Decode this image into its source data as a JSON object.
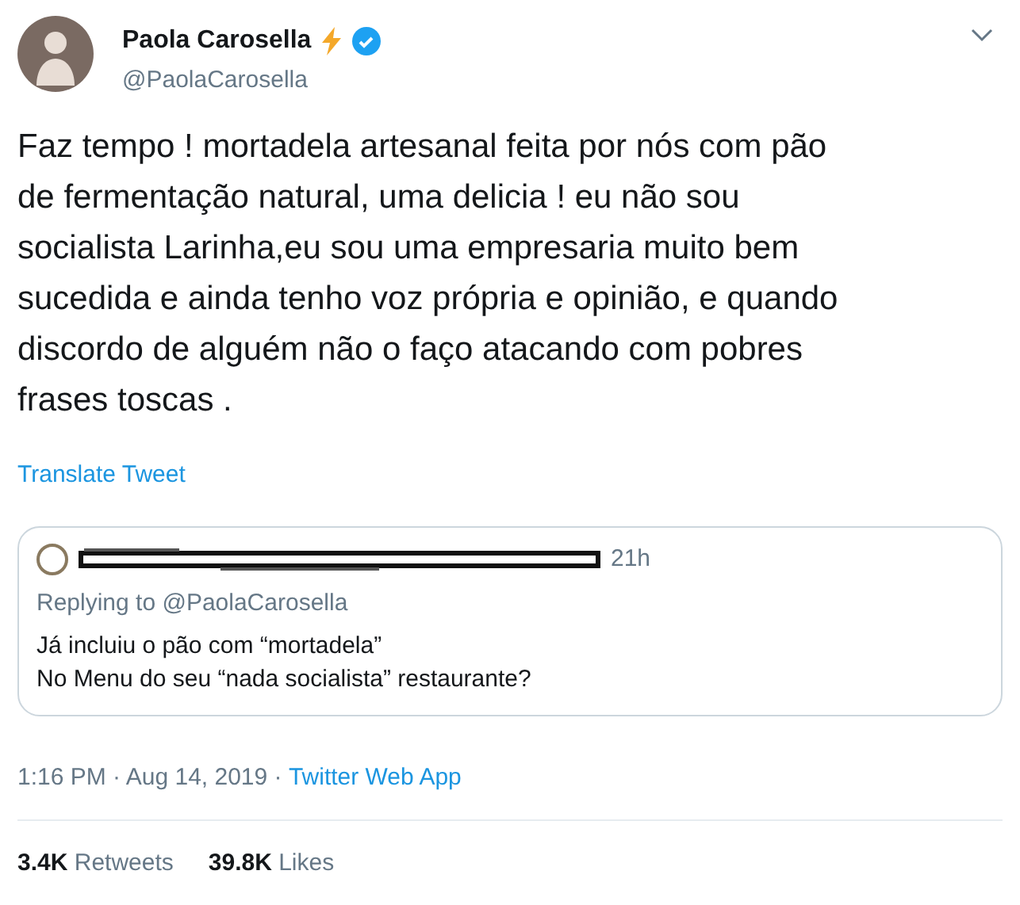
{
  "author": {
    "name": "Paola Carosella",
    "handle": "@PaolaCarosella",
    "verified": true
  },
  "text": "Faz tempo ! mortadela artesanal feita por nós com pão\nde fermentação natural, uma delicia !  eu não sou\nsocialista Larinha,eu sou uma empresaria muito bem\nsucedida e ainda tenho voz própria e opinião, e quando\ndiscordo de alguém não o faço atacando com pobres\nfrases toscas .",
  "translate_link": "Translate Tweet",
  "quoted_tweet": {
    "time": "21h",
    "replying_to": "Replying to @PaolaCarosella",
    "text": "Já incluiu o pão com “mortadela”\nNo Menu do seu “nada socialista” restaurante?"
  },
  "timestamp": "1:16 PM · Aug 14, 2019 · ",
  "source": "Twitter Web App",
  "stats": [
    {
      "count": "3.4K",
      "label": "Retweets"
    },
    {
      "count": "39.8K",
      "label": "Likes"
    }
  ]
}
